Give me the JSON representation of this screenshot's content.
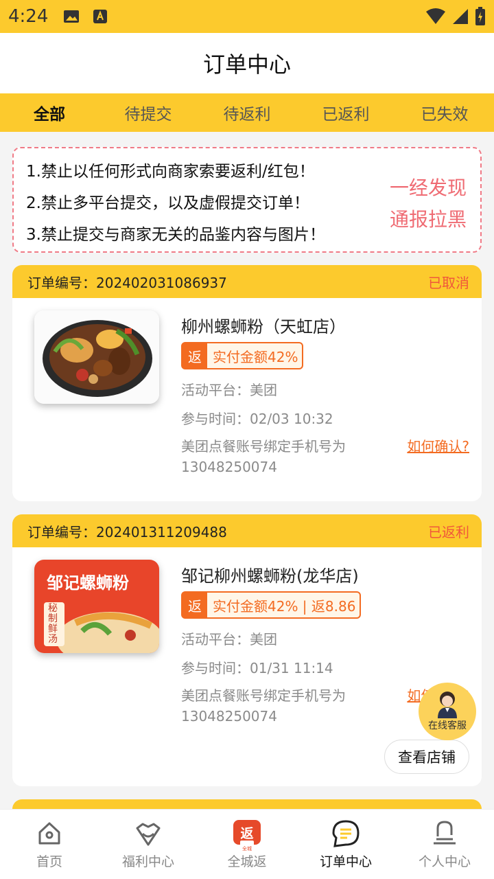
{
  "status_bar": {
    "time": "4:24"
  },
  "header": {
    "title": "订单中心"
  },
  "tabs": [
    {
      "label": "全部",
      "active": true
    },
    {
      "label": "待提交"
    },
    {
      "label": "待返利"
    },
    {
      "label": "已返利"
    },
    {
      "label": "已失效"
    }
  ],
  "notice": {
    "lines": [
      "1.禁止以任何形式向商家索要返利/红包！",
      "2.禁止多平台提交，以及虚假提交订单！",
      "3.禁止提交与商家无关的品鉴内容与图片！"
    ],
    "warning_line1": "一经发现",
    "warning_line2": "通报拉黑"
  },
  "orders": [
    {
      "order_label": "订单编号：202402031086937",
      "status": "已取消",
      "shop": "柳州螺蛳粉（天虹店）",
      "rebate_badge": "返",
      "rebate_text": "实付金额42%",
      "platform": "活动平台：美团",
      "time": "参与时间：02/03 10:32",
      "phone_label": "美团点餐账号绑定手机号为",
      "phone": "13048250074",
      "how_link": "如何确认?"
    },
    {
      "order_label": "订单编号：202401311209488",
      "status": "已返利",
      "shop": "邹记柳州螺蛳粉(龙华店)",
      "rebate_badge": "返",
      "rebate_text": "实付金额42% | 返8.86",
      "platform": "活动平台：美团",
      "time": "参与时间：01/31 11:14",
      "phone_label": "美团点餐账号绑定手机号为",
      "phone": "13048250074",
      "how_link": "如何确认?",
      "store_button": "查看店铺",
      "banner_text": "邹记螺蛳粉",
      "banner_side": "秘制鲜汤"
    }
  ],
  "service": {
    "label": "在线客服"
  },
  "bottom_nav": [
    {
      "label": "首页",
      "icon": "home-icon"
    },
    {
      "label": "福利中心",
      "icon": "heart-gift-icon"
    },
    {
      "label": "全城返",
      "icon": "rebate-logo-icon",
      "logo_text": "返",
      "logo_sub": "全城"
    },
    {
      "label": "订单中心",
      "icon": "order-chat-icon",
      "active": true
    },
    {
      "label": "个人中心",
      "icon": "user-icon"
    }
  ],
  "colors": {
    "accent": "#fcca2d",
    "orange": "#f36b21",
    "warn": "#ef6b73",
    "status": "#f0573b"
  }
}
